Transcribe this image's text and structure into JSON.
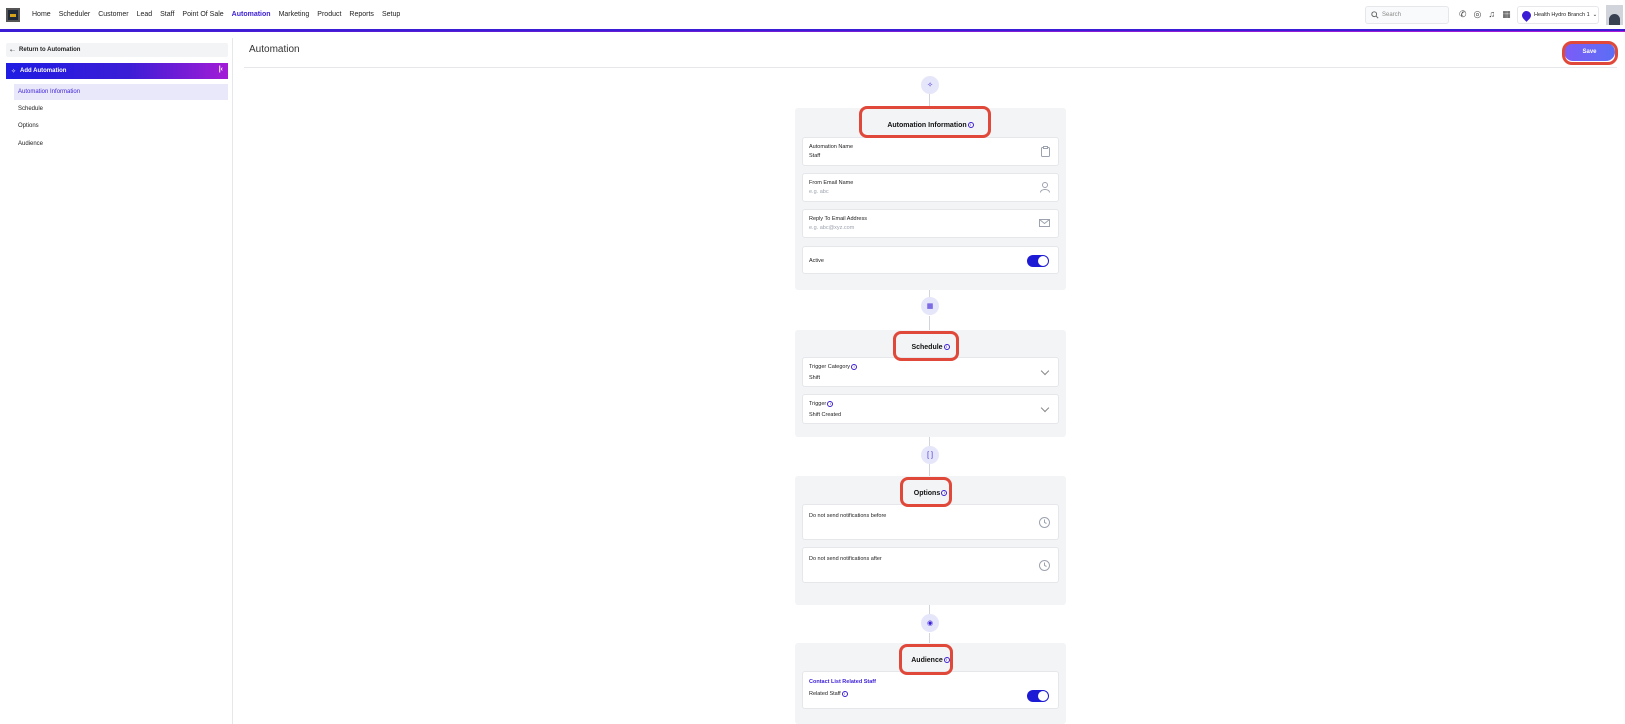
{
  "nav": {
    "items": [
      "Home",
      "Scheduler",
      "Customer",
      "Lead",
      "Staff",
      "Point Of Sale",
      "Automation",
      "Marketing",
      "Product",
      "Reports",
      "Setup"
    ],
    "active": "Automation"
  },
  "search": {
    "placeholder": "Search"
  },
  "branch": {
    "label": "Health Hydro Branch 1"
  },
  "sidebar": {
    "return_label": "Return to Automation",
    "header_label": "Add Automation",
    "items": [
      "Automation Information",
      "Schedule",
      "Options",
      "Audience"
    ],
    "selected": "Automation Information"
  },
  "main": {
    "title": "Automation",
    "save_label": "Save"
  },
  "automation_info": {
    "title": "Automation Information",
    "name_label": "Automation Name",
    "name_value": "Staff",
    "from_email_label": "From Email Name",
    "from_email_placeholder": "e.g. abc",
    "reply_label": "Reply To Email Address",
    "reply_placeholder": "e.g. abc@xyz.com",
    "active_label": "Active",
    "active_on": true
  },
  "schedule": {
    "title": "Schedule",
    "trigger_category_label": "Trigger Category",
    "trigger_category_value": "Shift",
    "trigger_label": "Trigger",
    "trigger_value": "Shift Created"
  },
  "options": {
    "title": "Options",
    "before_label": "Do not send notifications before",
    "after_label": "Do not send notifications after"
  },
  "audience": {
    "title": "Audience",
    "contact_list_label": "Contact List Related Staff",
    "related_staff_label": "Related Staff",
    "related_staff_on": true
  },
  "icons": {
    "info": "ⓘ",
    "clipboard": "📋",
    "user": "👤",
    "mail": "✉",
    "clock": "◷"
  },
  "colors": {
    "accent": "#3b1dd6",
    "highlight": "#e0493a"
  }
}
